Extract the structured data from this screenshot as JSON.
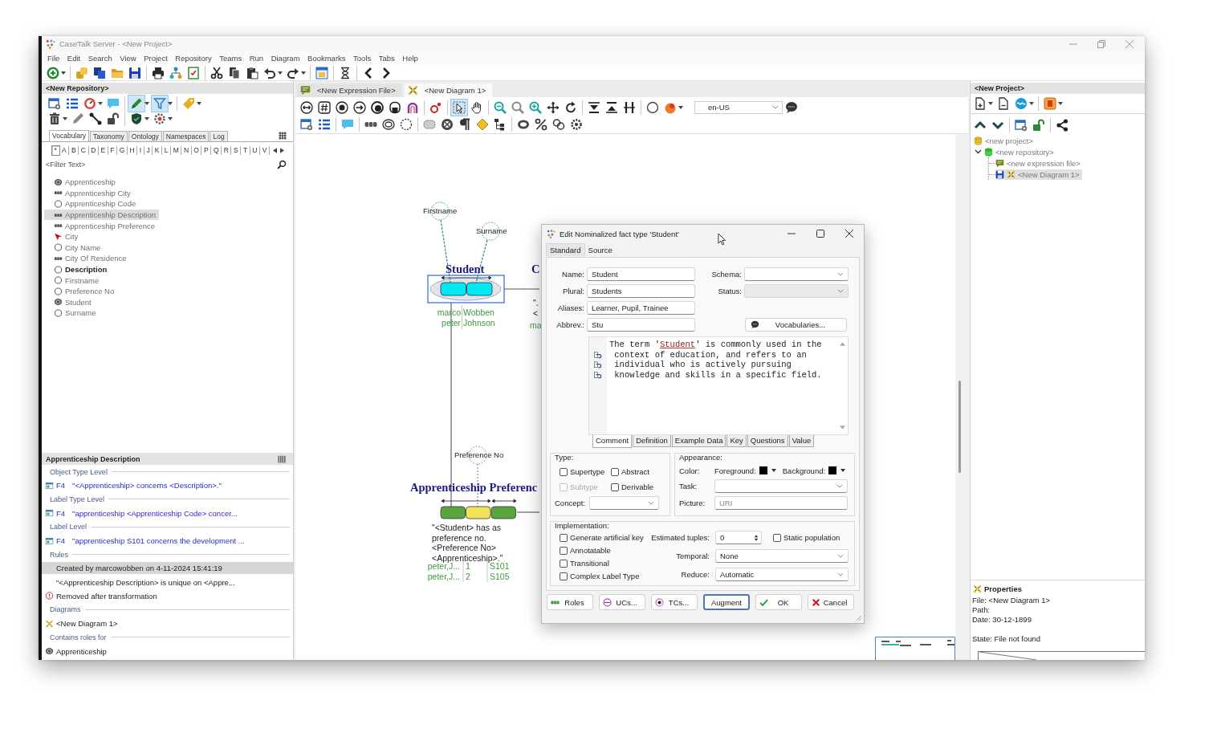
{
  "window": {
    "title": "CaseTalk Server - <New Project>"
  },
  "menu": [
    "File",
    "Edit",
    "Search",
    "View",
    "Project",
    "Repository",
    "Teams",
    "Run",
    "Diagram",
    "Bookmarks",
    "Tools",
    "Tabs",
    "Help"
  ],
  "repository_panel": {
    "title": "<New Repository>",
    "tools": [
      {
        "selected": false
      },
      {
        "selected": false
      },
      {
        "selected": false
      },
      {
        "selected": false
      },
      {
        "selected": true
      },
      {
        "selected": true
      },
      {
        "selected": false
      },
      {
        "selected": false
      },
      {
        "selected": false
      },
      {
        "selected": false
      },
      {
        "selected": false
      },
      {
        "selected": false
      },
      {
        "selected": false
      }
    ],
    "tabs": [
      {
        "label": "Vocabulary",
        "selected": true
      },
      {
        "label": "Taxonomy",
        "selected": false
      },
      {
        "label": "Ontology",
        "selected": false
      },
      {
        "label": "Namespaces",
        "selected": false
      },
      {
        "label": "Log",
        "selected": false
      }
    ],
    "letters": [
      {
        "label": "*",
        "selected": true
      },
      {
        "label": "A",
        "selected": false
      },
      {
        "label": "B",
        "selected": false
      },
      {
        "label": "C",
        "selected": false
      },
      {
        "label": "D",
        "selected": false
      },
      {
        "label": "E",
        "selected": false
      },
      {
        "label": "F",
        "selected": false
      },
      {
        "label": "G",
        "selected": false
      },
      {
        "label": "H",
        "selected": false
      },
      {
        "label": "I",
        "selected": false
      },
      {
        "label": "J",
        "selected": false
      },
      {
        "label": "K",
        "selected": false
      },
      {
        "label": "L",
        "selected": false
      },
      {
        "label": "M",
        "selected": false
      },
      {
        "label": "N",
        "selected": false
      },
      {
        "label": "O",
        "selected": false
      },
      {
        "label": "P",
        "selected": false
      },
      {
        "label": "Q",
        "selected": false
      },
      {
        "label": "R",
        "selected": false
      },
      {
        "label": "S",
        "selected": false
      },
      {
        "label": "T",
        "selected": false
      },
      {
        "label": "U",
        "selected": false
      },
      {
        "label": "V",
        "selected": false
      }
    ],
    "filter": {
      "placeholder": "<Filter Text>"
    },
    "items": [
      {
        "name": "Apprenticeship",
        "kind": "nominal",
        "selected": false,
        "bold": false
      },
      {
        "name": "Apprenticeship City",
        "kind": "fact",
        "selected": false,
        "bold": false
      },
      {
        "name": "Apprenticeship Code",
        "kind": "label",
        "selected": false,
        "bold": false
      },
      {
        "name": "Apprenticeship Description",
        "kind": "fact",
        "selected": true,
        "bold": false
      },
      {
        "name": "Apprenticeship Preference",
        "kind": "fact",
        "selected": false,
        "bold": false
      },
      {
        "name": "City",
        "kind": "arrow",
        "selected": false,
        "bold": false
      },
      {
        "name": "City Name",
        "kind": "label",
        "selected": false,
        "bold": false
      },
      {
        "name": "City Of Residence",
        "kind": "fact",
        "selected": false,
        "bold": false
      },
      {
        "name": "Description",
        "kind": "label",
        "selected": false,
        "bold": true
      },
      {
        "name": "Firstname",
        "kind": "label",
        "selected": false,
        "bold": false
      },
      {
        "name": "Preference No",
        "kind": "label",
        "selected": false,
        "bold": false
      },
      {
        "name": "Student",
        "kind": "nominal",
        "selected": false,
        "bold": false
      },
      {
        "name": "Surname",
        "kind": "label",
        "selected": false,
        "bold": false
      }
    ]
  },
  "details_panel": {
    "title": "Apprenticeship Description",
    "sections": [
      {
        "heading": "Object Type Level",
        "entries": [
          {
            "kind": "expression",
            "code": "F4",
            "text": "\"<Apprenticeship> concerns <Description>.\"",
            "selected": false
          }
        ]
      },
      {
        "heading": "Label Type Level",
        "entries": [
          {
            "kind": "expression",
            "code": "F4",
            "text": "\"apprenticeship <Apprenticeship Code> concer...",
            "selected": false
          }
        ]
      },
      {
        "heading": "Label Level",
        "entries": [
          {
            "kind": "expression",
            "code": "F4",
            "text": "\"apprenticeship S101 concerns the development ...",
            "selected": false
          }
        ]
      },
      {
        "heading": "Rules",
        "entries": [
          {
            "kind": "note",
            "text": "Created by marcowobben on 4-11-2024 15:41:19",
            "selected": true
          },
          {
            "kind": "rule",
            "text": "\"<Apprenticeship Description> is unique on <Appre...",
            "selected": false
          },
          {
            "kind": "warning",
            "text": "Removed after transformation",
            "selected": false
          }
        ]
      },
      {
        "heading": "Diagrams",
        "entries": [
          {
            "kind": "diagram",
            "text": "<New Diagram 1>",
            "selected": false
          }
        ]
      },
      {
        "heading": "Contains roles for",
        "entries": [
          {
            "kind": "nominal",
            "text": "Apprenticeship",
            "selected": false
          }
        ]
      }
    ]
  },
  "editor_tabs": [
    {
      "label": "<New Expression File>",
      "kind": "expression-file",
      "selected": false
    },
    {
      "label": "<New Diagram 1>",
      "kind": "diagram",
      "selected": true
    }
  ],
  "diagram_toolbar": {
    "tools": [
      {
        "selected": false
      },
      {
        "selected": false
      },
      {
        "selected": false
      },
      {
        "selected": false
      },
      {
        "selected": false
      },
      {
        "selected": false
      },
      {
        "selected": false
      },
      {
        "selected": false
      },
      {
        "selected": true
      },
      {
        "selected": false
      },
      {
        "selected": false
      },
      {
        "selected": false
      },
      {
        "selected": false
      },
      {
        "selected": false
      },
      {
        "selected": false
      },
      {
        "selected": false
      },
      {
        "selected": false
      },
      {
        "selected": false
      },
      {
        "selected": false
      },
      {
        "selected": false
      },
      {
        "selected": false
      },
      {
        "selected": false
      },
      {
        "selected": false
      },
      {
        "selected": false
      },
      {
        "selected": false
      },
      {
        "selected": false
      },
      {
        "selected": false
      },
      {
        "selected": false
      },
      {
        "selected": false
      },
      {
        "selected": false
      },
      {
        "selected": false
      },
      {
        "selected": false
      },
      {
        "selected": false
      },
      {
        "selected": false
      },
      {
        "selected": false
      }
    ],
    "language": "en-US"
  },
  "diagram": {
    "value_types": [
      {
        "label": "Firstname"
      },
      {
        "label": "Surname"
      },
      {
        "label": "Preference No"
      }
    ],
    "facts": [
      {
        "title": "Student",
        "kind": "nominalized",
        "selected": true,
        "roles": [
          {
            "color": "#00e8f0"
          },
          {
            "color": "#00e8f0"
          }
        ],
        "population": [
          [
            "marco",
            "Wobben"
          ],
          [
            "peter",
            "Johnson"
          ]
        ]
      },
      {
        "title": "C",
        "kind": "fact",
        "selected": false,
        "expression": [
          "\".",
          "<"
        ],
        "population": [
          [
            "ma"
          ]
        ]
      },
      {
        "title": "Apprenticeship Preferenc",
        "kind": "fact",
        "selected": false,
        "roles": [
          {
            "color": "#5aa53c"
          },
          {
            "color": "#f2e255"
          },
          {
            "color": "#5aa53c"
          }
        ],
        "expression": [
          "\"<Student> has as",
          "preference no.",
          "<Preference No>",
          "<Apprenticeship>.\""
        ],
        "population": [
          [
            "peter,J...",
            "1",
            "S101"
          ],
          [
            "peter,J...",
            "2",
            "S105"
          ]
        ]
      }
    ]
  },
  "dialog": {
    "title": "Edit Nominalized fact type 'Student'",
    "tabs": [
      {
        "label": "Standard",
        "selected": true
      },
      {
        "label": "Source",
        "selected": false
      }
    ],
    "fields": [
      {
        "label": "Name:",
        "value": "Student"
      },
      {
        "label": "Plural:",
        "value": "Students"
      },
      {
        "label": "Aliases:",
        "value": "Learner, Pupil, Trainee"
      },
      {
        "label": "Abbrev.:",
        "value": "Stu"
      }
    ],
    "selects": [
      {
        "label": "Schema:",
        "disabled": false
      },
      {
        "label": "Status:",
        "disabled": true
      }
    ],
    "vocabularies_button": "Vocabularies...",
    "comment": {
      "lines": [
        {
          "wrapped": false,
          "parts": [
            {
              "kind": "text",
              "text": "The term '"
            },
            {
              "kind": "link",
              "text": "Student"
            },
            {
              "kind": "text",
              "text": "' is commonly used in the"
            }
          ]
        },
        {
          "wrapped": true,
          "parts": [
            {
              "kind": "text",
              "text": "context of education, and refers to an"
            }
          ]
        },
        {
          "wrapped": true,
          "parts": [
            {
              "kind": "text",
              "text": "individual who is actively pursuing"
            }
          ]
        },
        {
          "wrapped": true,
          "parts": [
            {
              "kind": "text",
              "text": "knowledge and skills in a specific field."
            }
          ]
        }
      ]
    },
    "text_tabs": [
      {
        "label": "Comment",
        "selected": true
      },
      {
        "label": "Definition",
        "selected": false
      },
      {
        "label": "Example Data",
        "selected": false
      },
      {
        "label": "Key",
        "selected": false
      },
      {
        "label": "Questions",
        "selected": false
      },
      {
        "label": "Value",
        "selected": false
      }
    ],
    "type": {
      "legend": "Type:",
      "options": [
        {
          "label": "Supertype",
          "checked": false,
          "disabled": false
        },
        {
          "label": "Abstract",
          "checked": false,
          "disabled": false
        },
        {
          "label": "Subtype",
          "checked": false,
          "disabled": true
        },
        {
          "label": "Derivable",
          "checked": false,
          "disabled": false
        }
      ],
      "concept": {
        "label": "Concept:"
      }
    },
    "appearance": {
      "legend": "Appearance:",
      "color_label": "Color:",
      "colors": [
        {
          "label": "Foreground:",
          "color": "#000000"
        },
        {
          "label": "Background:",
          "color": "#000000"
        }
      ],
      "task": {
        "label": "Task:"
      },
      "picture": {
        "label": "Picture:",
        "placeholder": "URI"
      }
    },
    "implementation": {
      "legend": "Implementation:",
      "options": [
        {
          "label": "Generate artificial key",
          "checked": false
        },
        {
          "label": "Annotatable",
          "checked": false
        },
        {
          "label": "Transitional",
          "checked": false
        },
        {
          "label": "Complex Label Type",
          "checked": false
        }
      ],
      "estimated": {
        "label": "Estimated tuples:",
        "value": "0"
      },
      "static": {
        "label": "Static population",
        "checked": false
      },
      "selects": [
        {
          "label": "Temporal:",
          "value": "None"
        },
        {
          "label": "Reduce:",
          "value": "Automatic"
        }
      ]
    },
    "buttons": [
      {
        "label": "Roles",
        "kind": "roles",
        "focused": false
      },
      {
        "label": "UCs...",
        "kind": "ucs",
        "focused": false
      },
      {
        "label": "TCs...",
        "kind": "tcs",
        "focused": false
      },
      {
        "label": "Augment",
        "kind": "augment",
        "focused": true
      },
      {
        "label": "OK",
        "kind": "ok",
        "focused": false
      },
      {
        "label": "Cancel",
        "kind": "cancel",
        "focused": false
      }
    ]
  },
  "project_panel": {
    "title": "<New Project>",
    "tree": [
      {
        "label": "<new project>",
        "kind": "project",
        "selected": false
      },
      {
        "label": "<new repository>",
        "kind": "repository",
        "selected": false,
        "expanded": true,
        "children": [
          {
            "label": "<new expression file>",
            "kind": "expression-file",
            "selected": false
          },
          {
            "label": "<New Diagram 1>",
            "kind": "diagram",
            "selected": true
          }
        ]
      }
    ]
  },
  "properties": {
    "title": "Properties",
    "groups": [
      [
        "File: <New Diagram 1>",
        "Path:",
        "Date: 30-12-1899"
      ],
      [
        "State: File not found"
      ]
    ]
  }
}
